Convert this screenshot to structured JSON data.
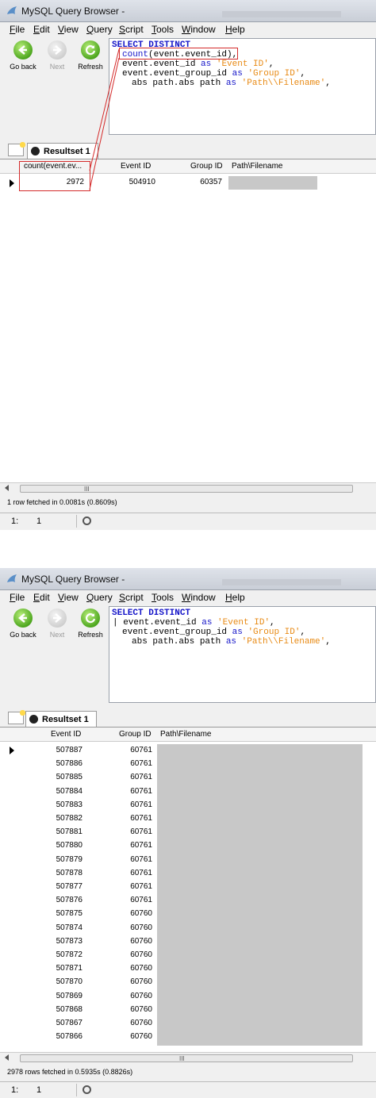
{
  "app": {
    "title": "MySQL Query Browser -"
  },
  "menu": [
    {
      "pre": "",
      "ul": "F",
      "post": "ile"
    },
    {
      "pre": "",
      "ul": "E",
      "post": "dit"
    },
    {
      "pre": "",
      "ul": "V",
      "post": "iew"
    },
    {
      "pre": "",
      "ul": "Q",
      "post": "uery"
    },
    {
      "pre": "",
      "ul": "S",
      "post": "cript"
    },
    {
      "pre": "",
      "ul": "T",
      "post": "ools"
    },
    {
      "pre": "",
      "ul": "W",
      "post": "indow"
    },
    {
      "pre": "",
      "ul": "H",
      "post": "elp"
    }
  ],
  "toolbar": {
    "back": "Go back",
    "next": "Next",
    "refresh": "Refresh"
  },
  "icons": {
    "back": "arrow-left-icon",
    "next": "arrow-right-icon",
    "refresh": "refresh-icon",
    "app": "dolphin-icon",
    "tab": "resultset-icon",
    "newtab": "new-tab-icon"
  },
  "colors": {
    "keyword": "#1414c8",
    "string": "#e88a14",
    "highlight": "#d42a2a",
    "cell_gray": "#c8c8c8"
  },
  "query1": {
    "l1": "SELECT DISTINCT",
    "l2_fn": "count",
    "l2_rest": "(event.event_id),",
    "l3_a": "event.event_id ",
    "l3_as": "as",
    "l3_s": "'Event ID'",
    "l3_c": ",",
    "l4_a": "event.event_group_id ",
    "l4_as": "as",
    "l4_s": "'Group ID'",
    "l4_c": ",",
    "l5_a": "abs path.abs path ",
    "l5_as": "as",
    "l5_s": "'Path\\\\Filename'",
    "l5_c": ","
  },
  "query2": {
    "l1": "SELECT DISTINCT",
    "l2_a": "| event.event_id ",
    "l2_as": "as",
    "l2_s": "'Event ID'",
    "l2_c": ",",
    "l3_a": "event.event_group_id ",
    "l3_as": "as",
    "l3_s": "'Group ID'",
    "l3_c": ",",
    "l4_a": "abs path.abs path ",
    "l4_as": "as",
    "l4_s": "'Path\\\\Filename'",
    "l4_c": ","
  },
  "tab": {
    "label": "Resultset 1"
  },
  "result1": {
    "headers": [
      "count(event.ev...",
      "Event ID",
      "Group ID",
      "Path\\Filename"
    ],
    "rows": [
      [
        "2972",
        "504910",
        "60357",
        ""
      ]
    ],
    "status": "1 row fetched in 0.0081s (0.8609s)"
  },
  "result2": {
    "headers": [
      "Event ID",
      "Group ID",
      "Path\\Filename"
    ],
    "rows": [
      [
        "507887",
        "60761"
      ],
      [
        "507886",
        "60761"
      ],
      [
        "507885",
        "60761"
      ],
      [
        "507884",
        "60761"
      ],
      [
        "507883",
        "60761"
      ],
      [
        "507882",
        "60761"
      ],
      [
        "507881",
        "60761"
      ],
      [
        "507880",
        "60761"
      ],
      [
        "507879",
        "60761"
      ],
      [
        "507878",
        "60761"
      ],
      [
        "507877",
        "60761"
      ],
      [
        "507876",
        "60761"
      ],
      [
        "507875",
        "60760"
      ],
      [
        "507874",
        "60760"
      ],
      [
        "507873",
        "60760"
      ],
      [
        "507872",
        "60760"
      ],
      [
        "507871",
        "60760"
      ],
      [
        "507870",
        "60760"
      ],
      [
        "507869",
        "60760"
      ],
      [
        "507868",
        "60760"
      ],
      [
        "507867",
        "60760"
      ],
      [
        "507866",
        "60760"
      ]
    ],
    "status": "2978 rows fetched in 0.5935s (0.8826s)"
  },
  "statusbar": {
    "line": "1:",
    "col": "1"
  },
  "scroll": {
    "grip": "III"
  }
}
